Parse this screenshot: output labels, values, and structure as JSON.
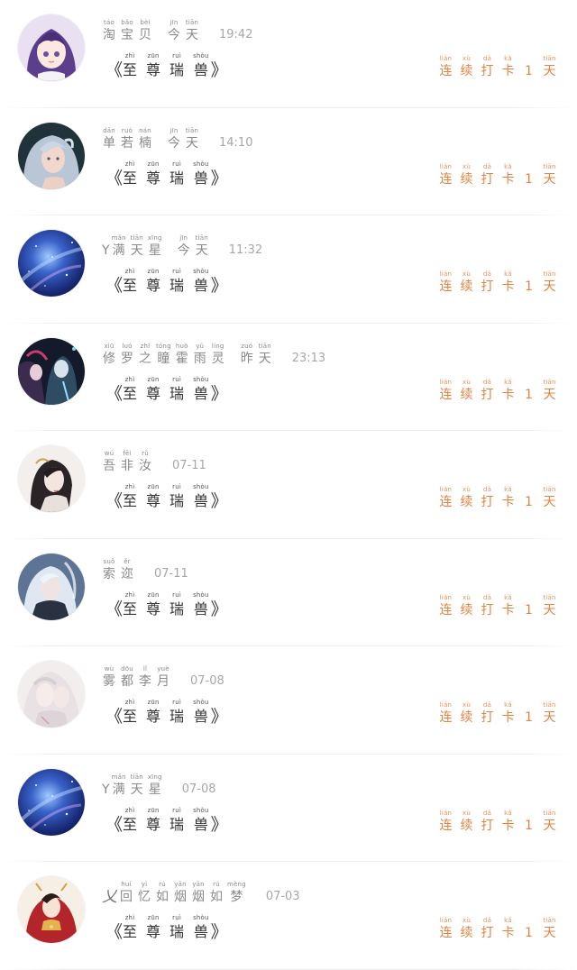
{
  "colors": {
    "accent_streak": "#e4823f",
    "name_text": "#8a8a8a",
    "time_text": "#a7a7a7",
    "title_text": "#333333",
    "divider": "#ececec"
  },
  "title": {
    "open": "《",
    "close": "》",
    "chars": [
      {
        "py": "zhì",
        "hz": "至"
      },
      {
        "py": "zūn",
        "hz": "尊"
      },
      {
        "py": "ruì",
        "hz": "瑞"
      },
      {
        "py": "shòu",
        "hz": "兽"
      }
    ]
  },
  "streak": {
    "chars": [
      {
        "py": "lián",
        "hz": "连"
      },
      {
        "py": "xù",
        "hz": "续"
      },
      {
        "py": "dǎ",
        "hz": "打"
      },
      {
        "py": "kǎ",
        "hz": "卡"
      },
      {
        "py": "",
        "hz": "1"
      },
      {
        "py": "tiān",
        "hz": "天"
      }
    ]
  },
  "entries": [
    {
      "avatar": "avatar-anime-girl-purple",
      "prefix": "",
      "name": [
        {
          "py": "táo",
          "hz": "淘"
        },
        {
          "py": "bǎo",
          "hz": "宝"
        },
        {
          "py": "bèi",
          "hz": "贝"
        }
      ],
      "day": [
        {
          "py": "jīn",
          "hz": "今"
        },
        {
          "py": "tiān",
          "hz": "天"
        }
      ],
      "time": "19:42"
    },
    {
      "avatar": "avatar-silver-hair-girl",
      "prefix": "",
      "name": [
        {
          "py": "dān",
          "hz": "单"
        },
        {
          "py": "ruò",
          "hz": "若"
        },
        {
          "py": "nán",
          "hz": "楠"
        }
      ],
      "day": [
        {
          "py": "jīn",
          "hz": "今"
        },
        {
          "py": "tiān",
          "hz": "天"
        }
      ],
      "time": "14:10"
    },
    {
      "avatar": "avatar-galaxy",
      "prefix": "Y",
      "name": [
        {
          "py": "mǎn",
          "hz": "满"
        },
        {
          "py": "tiān",
          "hz": "天"
        },
        {
          "py": "xīng",
          "hz": "星"
        }
      ],
      "day": [
        {
          "py": "jīn",
          "hz": "今"
        },
        {
          "py": "tiān",
          "hz": "天"
        }
      ],
      "time": "11:32"
    },
    {
      "avatar": "avatar-dark-couple",
      "prefix": "",
      "name": [
        {
          "py": "xiū",
          "hz": "修"
        },
        {
          "py": "luó",
          "hz": "罗"
        },
        {
          "py": "zhī",
          "hz": "之"
        },
        {
          "py": "tóng",
          "hz": "瞳"
        },
        {
          "py": "huò",
          "hz": "霍"
        },
        {
          "py": "yǔ",
          "hz": "雨"
        },
        {
          "py": "líng",
          "hz": "灵"
        }
      ],
      "day": [
        {
          "py": "zuó",
          "hz": "昨"
        },
        {
          "py": "tiān",
          "hz": "天"
        }
      ],
      "time": "23:13"
    },
    {
      "avatar": "avatar-ink-man",
      "prefix": "",
      "name": [
        {
          "py": "wú",
          "hz": "吾"
        },
        {
          "py": "fēi",
          "hz": "非"
        },
        {
          "py": "rǔ",
          "hz": "汝"
        }
      ],
      "day": [],
      "time": "07-11"
    },
    {
      "avatar": "avatar-white-hair-man",
      "prefix": "",
      "name": [
        {
          "py": "suǒ",
          "hz": "索"
        },
        {
          "py": "ěr",
          "hz": "迩"
        }
      ],
      "day": [],
      "time": "07-11"
    },
    {
      "avatar": "avatar-pale-couple",
      "prefix": "",
      "name": [
        {
          "py": "wù",
          "hz": "雾"
        },
        {
          "py": "dōu",
          "hz": "都"
        },
        {
          "py": "lǐ",
          "hz": "李"
        },
        {
          "py": "yuè",
          "hz": "月"
        }
      ],
      "day": [],
      "time": "07-08"
    },
    {
      "avatar": "avatar-galaxy",
      "prefix": "Y",
      "name": [
        {
          "py": "mǎn",
          "hz": "满"
        },
        {
          "py": "tiān",
          "hz": "天"
        },
        {
          "py": "xīng",
          "hz": "星"
        }
      ],
      "day": [],
      "time": "07-08"
    },
    {
      "avatar": "avatar-red-robe-man",
      "prefix": "乂",
      "name": [
        {
          "py": "huí",
          "hz": "回"
        },
        {
          "py": "yì",
          "hz": "忆"
        },
        {
          "py": "rú",
          "hz": "如"
        },
        {
          "py": "yān",
          "hz": "烟"
        },
        {
          "py": "yān",
          "hz": "烟"
        },
        {
          "py": "rú",
          "hz": "如"
        },
        {
          "py": "mèng",
          "hz": "梦"
        }
      ],
      "day": [],
      "time": "07-03"
    }
  ]
}
